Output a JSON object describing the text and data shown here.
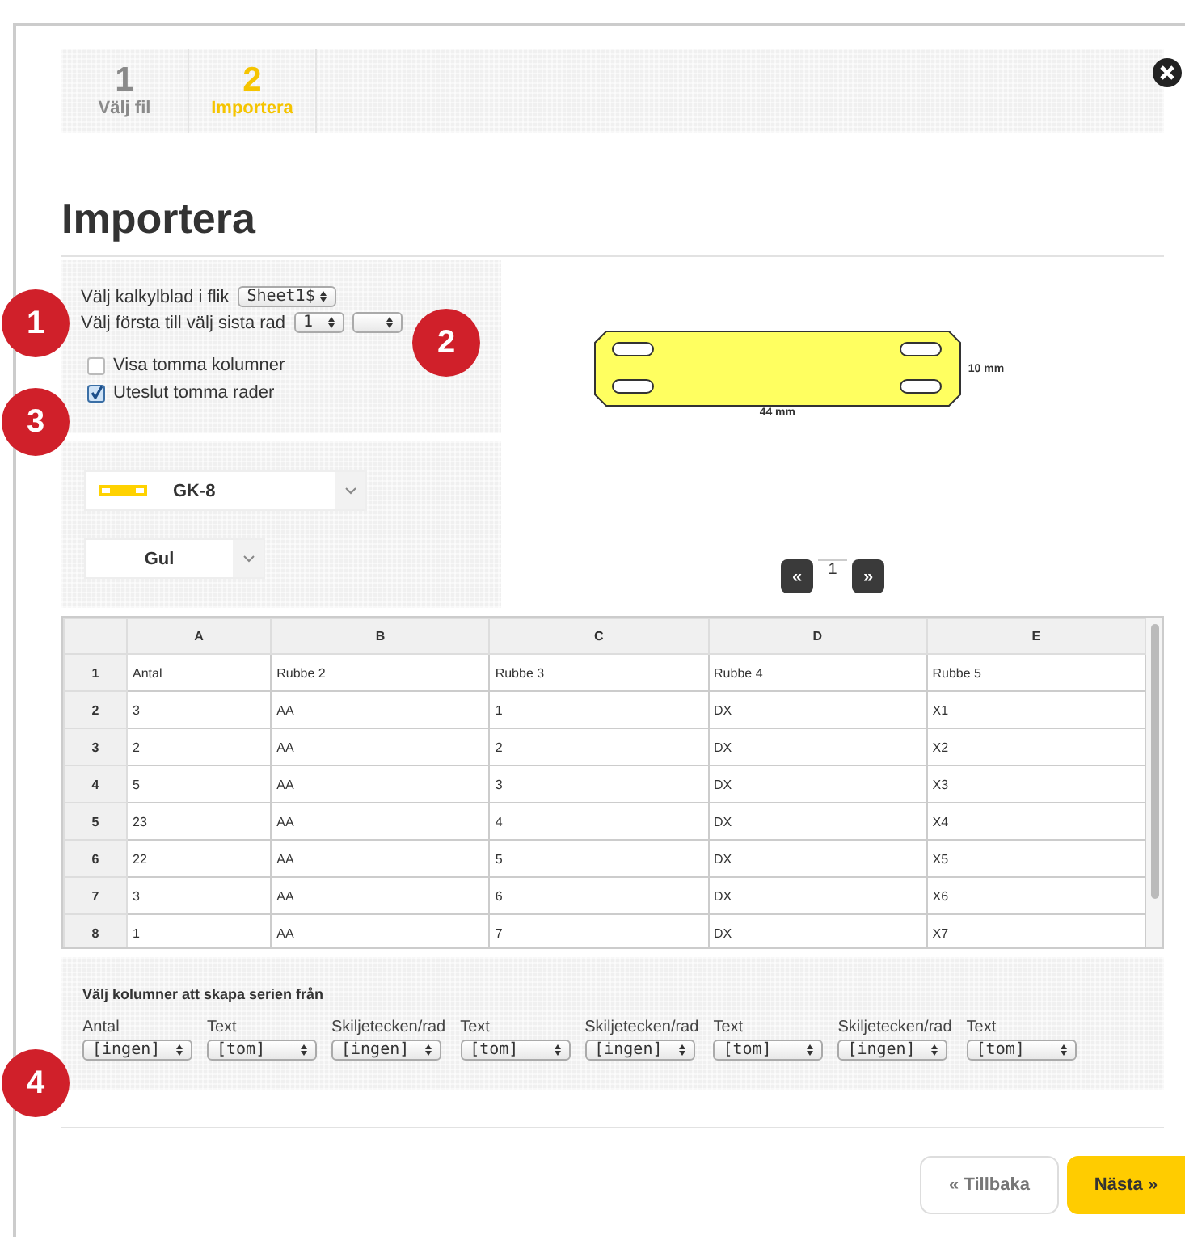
{
  "steps": [
    {
      "number": "1",
      "label": "Välj fil",
      "selected": false
    },
    {
      "number": "2",
      "label": "Importera",
      "selected": true
    }
  ],
  "title": "Importera",
  "sheet_select": {
    "label": "Välj kalkylblad i flik",
    "value": "Sheet1$"
  },
  "row_range": {
    "label": "Välj första till välj sista rad",
    "first": "1"
  },
  "options": [
    {
      "label": "Visa tomma kolumner",
      "checked": false
    },
    {
      "label": "Uteslut tomma rader",
      "checked": true
    }
  ],
  "product": {
    "name": "GK-8"
  },
  "color_select": {
    "value": "Gul"
  },
  "preview": {
    "height_label": "10 mm",
    "width_label": "44 mm"
  },
  "pager": {
    "prev": "«",
    "page": "1",
    "next": "»"
  },
  "table": {
    "columns": [
      "A",
      "B",
      "C",
      "D",
      "E"
    ],
    "rows": [
      {
        "number": "1",
        "cells": [
          "Antal",
          "Rubbe 2",
          "Rubbe 3",
          "Rubbe 4",
          "Rubbe 5"
        ]
      },
      {
        "number": "2",
        "cells": [
          "3",
          "AA",
          "1",
          "DX",
          "X1"
        ]
      },
      {
        "number": "3",
        "cells": [
          "2",
          "AA",
          "2",
          "DX",
          "X2"
        ]
      },
      {
        "number": "4",
        "cells": [
          "5",
          "AA",
          "3",
          "DX",
          "X3"
        ]
      },
      {
        "number": "5",
        "cells": [
          "23",
          "AA",
          "4",
          "DX",
          "X4"
        ]
      },
      {
        "number": "6",
        "cells": [
          "22",
          "AA",
          "5",
          "DX",
          "X5"
        ]
      },
      {
        "number": "7",
        "cells": [
          "3",
          "AA",
          "6",
          "DX",
          "X6"
        ]
      },
      {
        "number": "8",
        "cells": [
          "1",
          "AA",
          "7",
          "DX",
          "X7"
        ]
      }
    ]
  },
  "column_mapping": {
    "title": "Välj kolumner att skapa serien från",
    "fields": [
      {
        "label": "Antal",
        "value": "[ingen]"
      },
      {
        "label": "Text",
        "value": "[tom]"
      },
      {
        "label": "Skiljetecken/rad",
        "value": "[ingen]"
      },
      {
        "label": "Text",
        "value": "[tom]"
      },
      {
        "label": "Skiljetecken/rad",
        "value": "[ingen]"
      },
      {
        "label": "Text",
        "value": "[tom]"
      },
      {
        "label": "Skiljetecken/rad",
        "value": "[ingen]"
      },
      {
        "label": "Text",
        "value": "[tom]"
      }
    ]
  },
  "badges": [
    "1",
    "2",
    "3",
    "4"
  ],
  "buttons": {
    "back": "« Tillbaka",
    "next": "Nästa »"
  }
}
